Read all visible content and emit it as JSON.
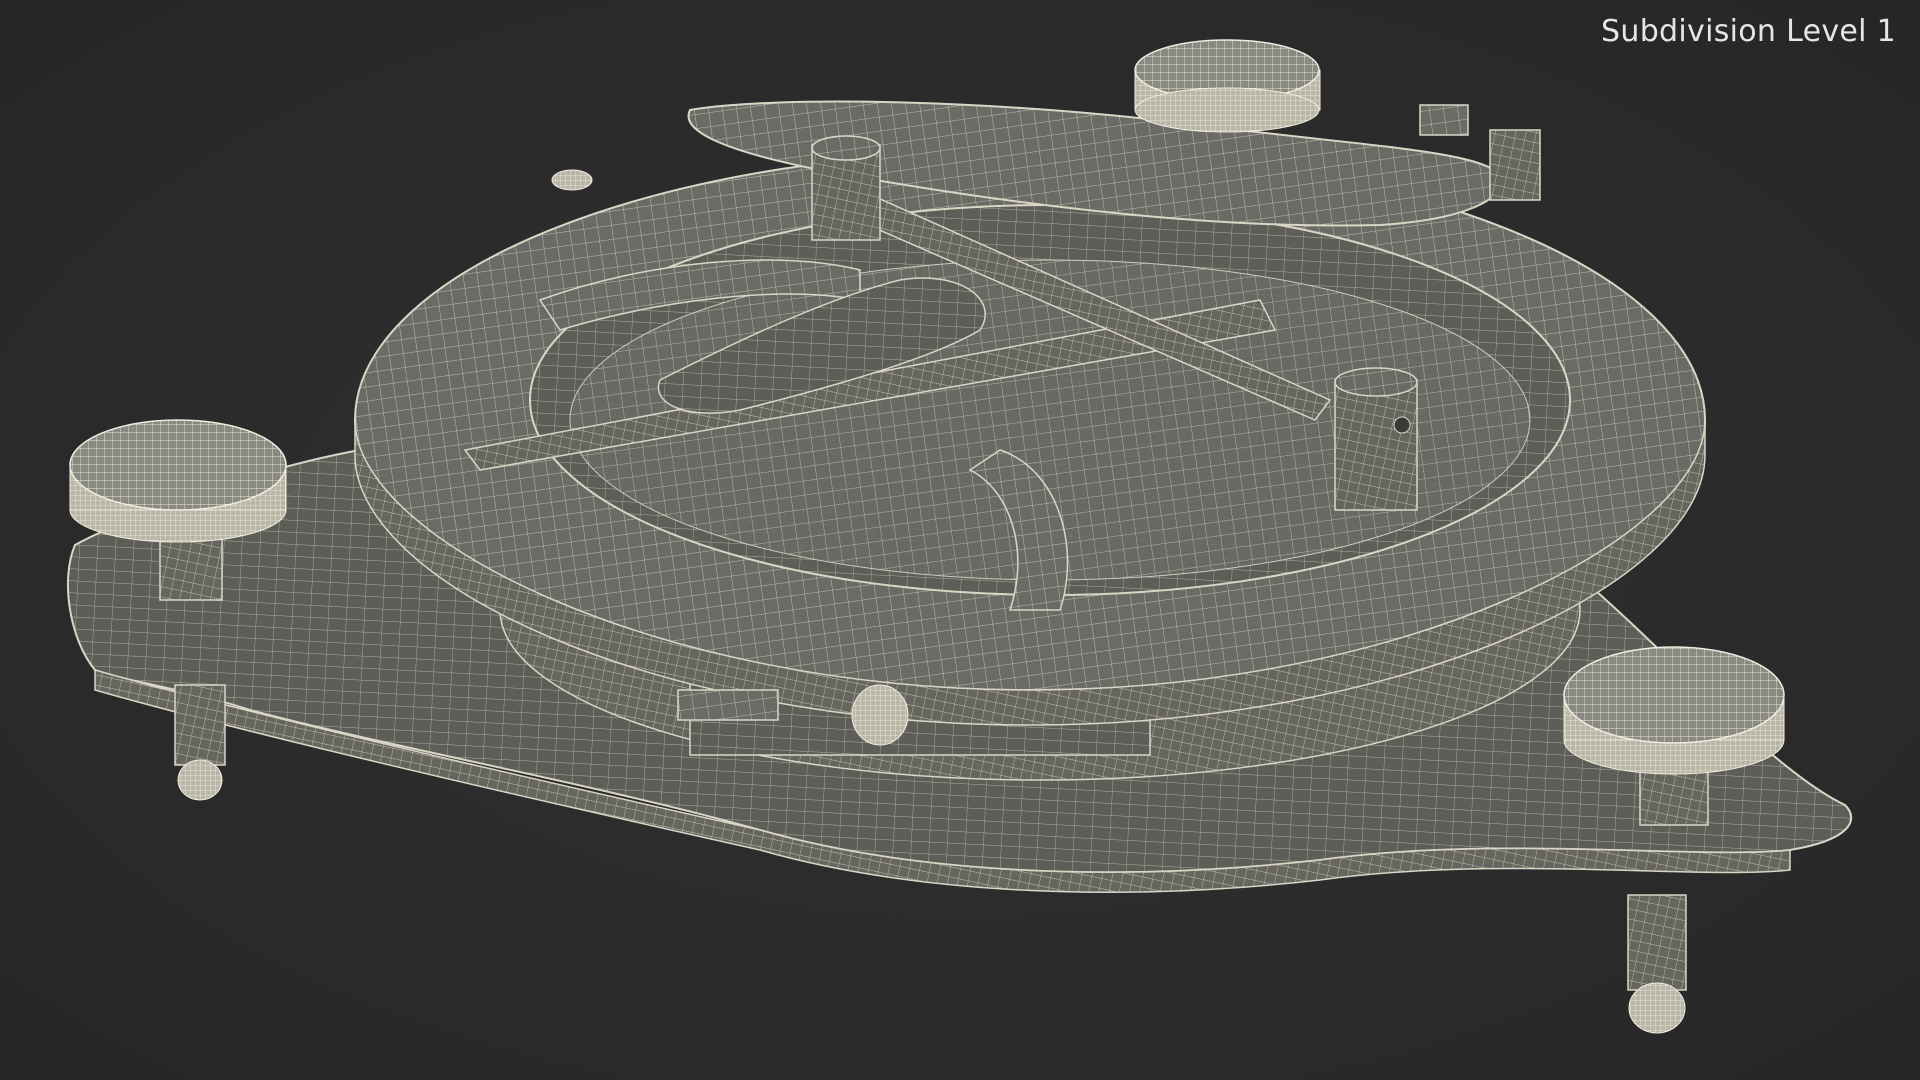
{
  "viewport": {
    "subdivision_label": "Subdivision Level 1"
  },
  "colors": {
    "background": "#2b2b2b",
    "mesh_fill": "#6b6b66",
    "mesh_dark": "#55554f",
    "mesh_light": "#7d7d77",
    "wire": "#d9d6c6",
    "label_text": "#e6e6e6"
  },
  "model": {
    "subject": "wireframe-3d-model"
  }
}
